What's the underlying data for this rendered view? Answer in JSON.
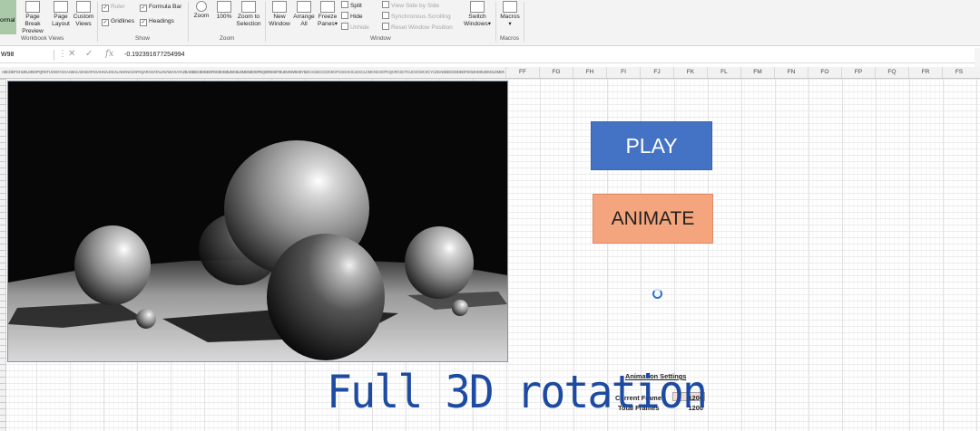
{
  "ribbon": {
    "normal_label": "ormal",
    "page_break_label_1": "Page Break",
    "page_break_label_2": "Preview",
    "page_layout_label_1": "Page",
    "page_layout_label_2": "Layout",
    "custom_views_label_1": "Custom",
    "custom_views_label_2": "Views",
    "ruler_label": "Ruler",
    "gridlines_label": "Gridlines",
    "formula_bar_label": "Formula Bar",
    "headings_label": "Headings",
    "zoom_label": "Zoom",
    "zoom100_label": "100%",
    "zoom_sel_label_1": "Zoom to",
    "zoom_sel_label_2": "Selection",
    "new_window_label_1": "New",
    "new_window_label_2": "Window",
    "arrange_label_1": "Arrange",
    "arrange_label_2": "All",
    "freeze_label_1": "Freeze",
    "freeze_label_2": "Panes",
    "split_label": "Split",
    "hide_label": "Hide",
    "unhide_label": "Unhide",
    "side_label": "View Side by Side",
    "sync_label": "Synchronous Scrolling",
    "reset_label": "Reset Window Position",
    "switch_label_1": "Switch",
    "switch_label_2": "Windows",
    "macros_label": "Macros",
    "groups": [
      "Workbook Views",
      "Show",
      "Zoom",
      "Window",
      "Macros"
    ]
  },
  "formula_bar": {
    "name_box": "W98",
    "fx": "fx",
    "value": "-0.192391677254994"
  },
  "columns": {
    "narrow_letters": "ABCDEFGHIJKLMNOPQRSTUVWXYZAAABACADAEAFAGAHAIAJAKALAMANAOAPAQARASATAUAVAWAXAYAZBABBBCBDBEBFBGBHBIBJBKBLBMBNBOBPBQBRBSBTBUBVBWBXBYBZCACBCCCDCECFCGCHCICJCKCLCMCNCOCPCQCRCSCTCUCVCWCXCYCZDADBDCDDDEDFDGDHDIDJDKDLDMDNDODPDQDRDSDTDUDVDWDXDYDZEAEBECEDEEEFEGEHEIEJEKELEMENEOEPEQERESETEUEVEWEXEYEZFAFBFCFDFE",
    "wide": [
      "FF",
      "FG",
      "FH",
      "FI",
      "FJ",
      "FK",
      "FL",
      "FM",
      "FN",
      "FO",
      "FP",
      "FQ",
      "FR",
      "FS"
    ]
  },
  "buttons": {
    "play": "PLAY",
    "animate": "ANIMATE"
  },
  "settings": {
    "title": "Animation Settings",
    "current_frame_label": "Current Frame",
    "current_frame_value": "1200",
    "total_frames_label": "Total Frames",
    "total_frames_value": "1200"
  },
  "caption": "Full 3D rotation",
  "colors": {
    "play": "#4472c4",
    "animate": "#f4a57e",
    "caption": "#1d4ba1"
  }
}
